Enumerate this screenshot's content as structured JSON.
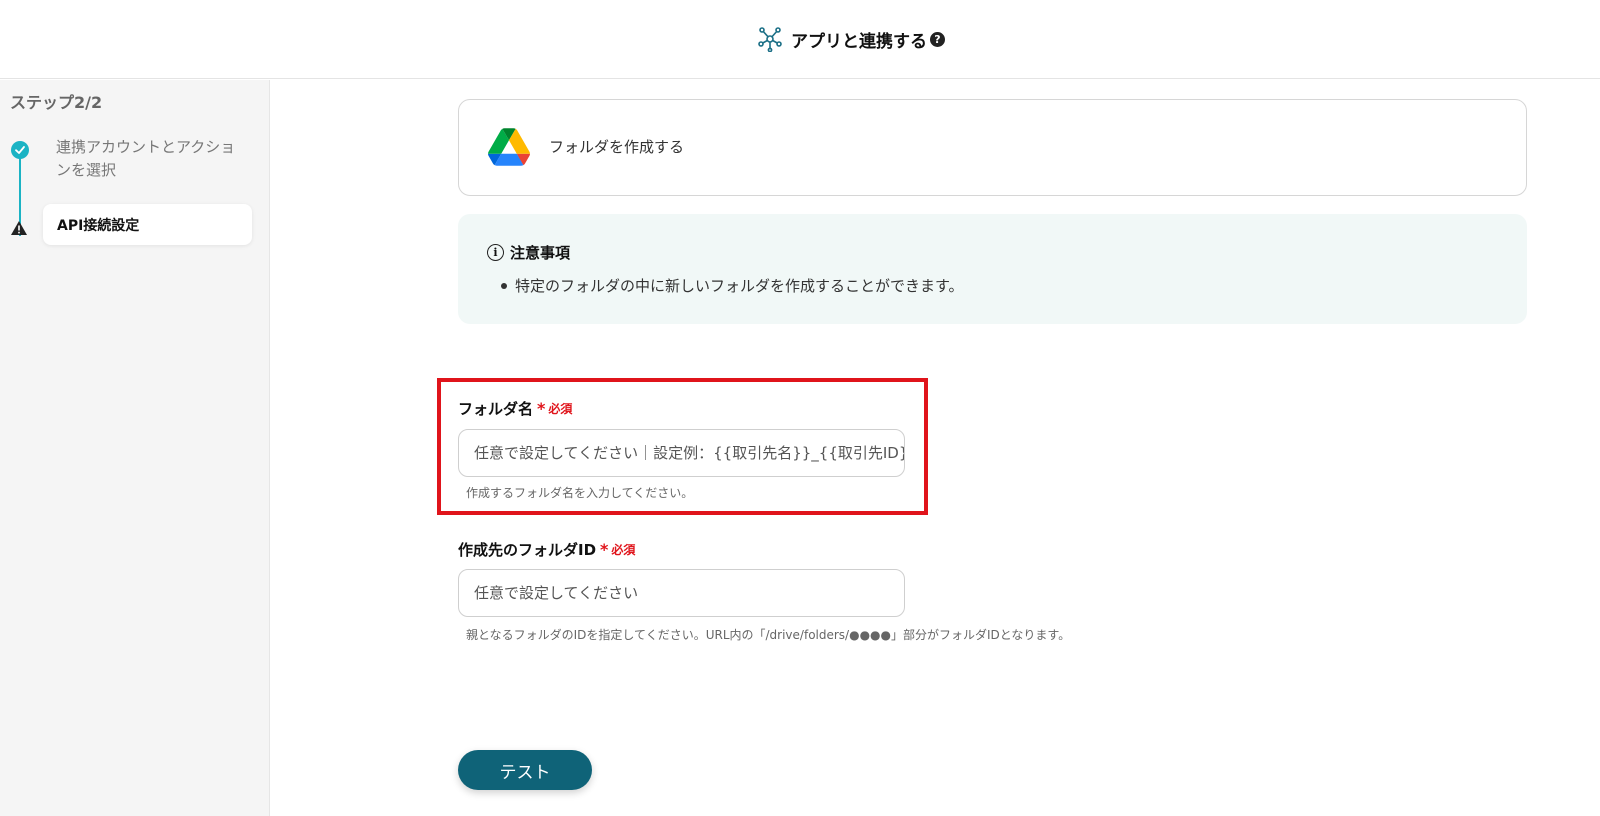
{
  "header": {
    "title": "アプリと連携する",
    "help_glyph": "?"
  },
  "sidebar": {
    "step_label": "ステップ2/2",
    "steps": [
      {
        "label": "連携アカウントとアクションを選択",
        "status": "done"
      },
      {
        "label": "API接続設定",
        "status": "warning"
      }
    ]
  },
  "app_card": {
    "action_label": "フォルダを作成する",
    "icon": "google-drive-icon"
  },
  "notice": {
    "title": "注意事項",
    "items": [
      "特定のフォルダの中に新しいフォルダを作成することができます。"
    ]
  },
  "form": {
    "folder_name": {
      "label": "フォルダ名",
      "required_star": "*",
      "required_text": "必須",
      "placeholder": "任意で設定してください｜設定例：{{取引先名}}_{{取引先ID}}",
      "help": "作成するフォルダ名を入力してください。"
    },
    "parent_folder_id": {
      "label": "作成先のフォルダID",
      "required_star": "*",
      "required_text": "必須",
      "placeholder": "任意で設定してください",
      "help": "親となるフォルダのIDを指定してください。URL内の「/drive/folders/●●●●」部分がフォルダIDとなります。"
    }
  },
  "test_button": {
    "label": "テスト"
  },
  "colors": {
    "accent": "#1bb3c4",
    "button": "#0f6378",
    "required": "#e0141b",
    "notice_bg": "#f1f8f7"
  }
}
